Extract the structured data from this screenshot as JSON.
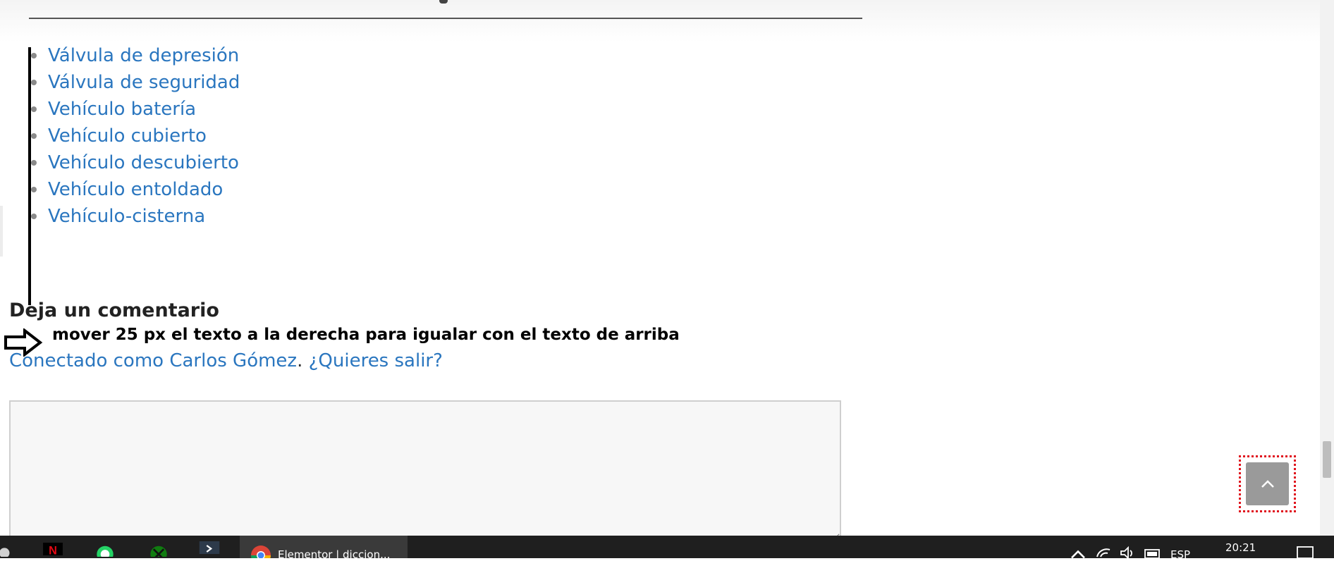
{
  "related_links": [
    "Válvula de depresión",
    "Válvula de seguridad",
    "Vehículo batería",
    "Vehículo cubierto",
    "Vehículo descubierto",
    "Vehículo entoldado",
    "Vehículo-cisterna"
  ],
  "comments": {
    "title": "Deja un comentario",
    "logged_in_prefix": "Conectado como Carlos Gómez",
    "logged_in_separator": ".",
    "logout_link": "¿Quieres salir?"
  },
  "annotation": {
    "note": "mover 25 px el texto a la derecha para igualar con el texto de arriba",
    "color": "#000000"
  },
  "scroll_to_top": {
    "icon": "chevron-up-icon",
    "highlight_color": "#e0141e"
  },
  "taskbar": {
    "chrome_tab_label": "Elementor | diccion...",
    "language": "ESP",
    "time": "20:21",
    "icons": [
      "windows-icon",
      "netflix-icon",
      "whatsapp-icon",
      "xbox-icon",
      "terminal-icon",
      "chrome-icon",
      "chevron-up-icon",
      "wifi-icon",
      "volume-icon",
      "battery-icon",
      "notification-icon"
    ]
  },
  "colors": {
    "link": "#2a76bf",
    "text": "#222222",
    "taskbar": "#1f1f1f"
  }
}
